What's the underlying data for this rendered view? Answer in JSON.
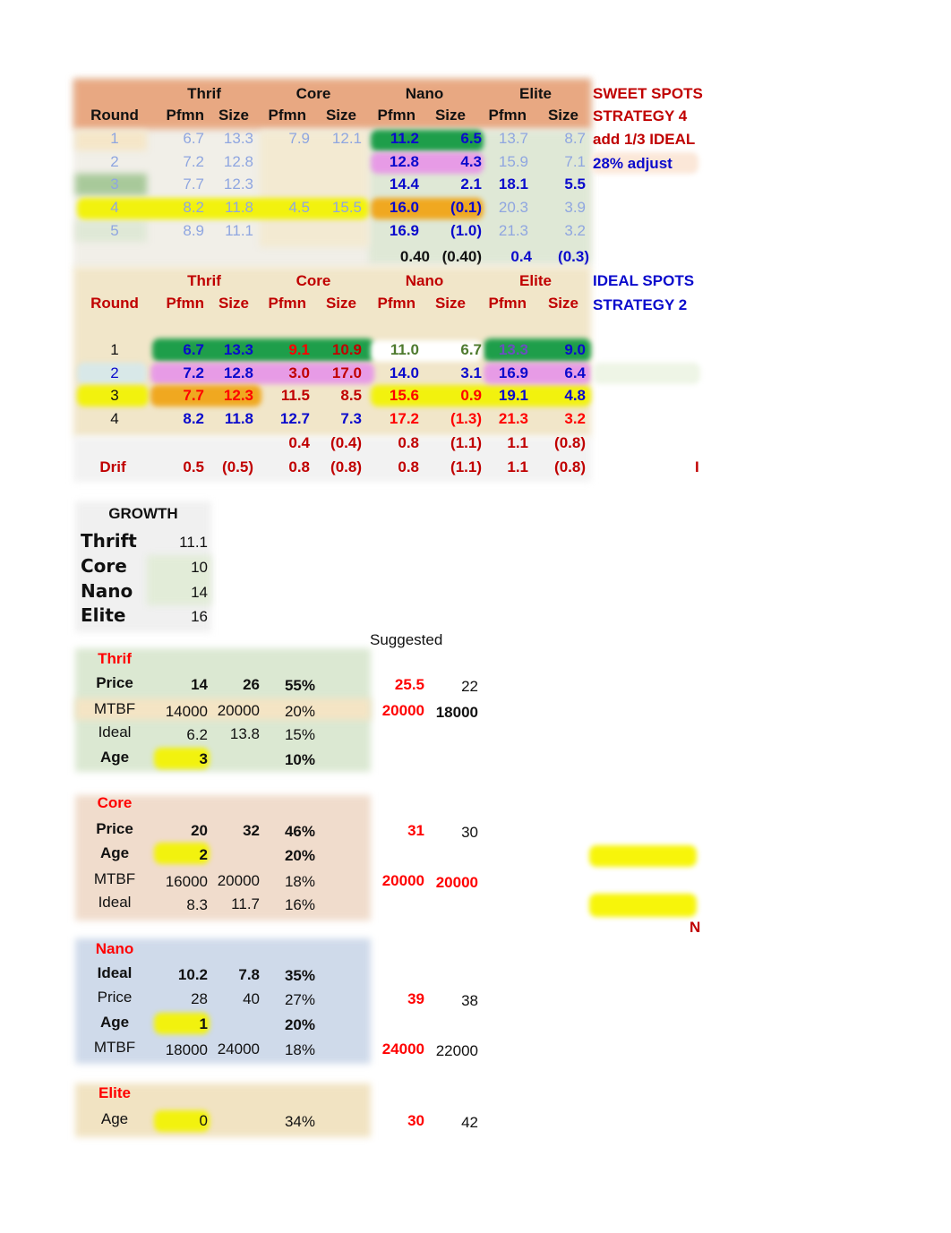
{
  "sweet_spots": {
    "side_labels": [
      "SWEET SPOTS",
      "STRATEGY 4",
      "add 1/3 IDEAL",
      "28% adjust"
    ],
    "groups": [
      "Thrif",
      "Core",
      "Nano",
      "Elite"
    ],
    "headers": [
      "Round",
      "Pfmn",
      "Size",
      "Pfmn",
      "Size",
      "Pfmn",
      "Size",
      "Pfmn",
      "Size"
    ],
    "rows": [
      [
        "1",
        "6.7",
        "13.3",
        "7.9",
        "12.1",
        "11.2",
        "6.5",
        "13.7",
        "8.7"
      ],
      [
        "2",
        "7.2",
        "12.8",
        "",
        "",
        "12.8",
        "4.3",
        "15.9",
        "7.1"
      ],
      [
        "3",
        "7.7",
        "12.3",
        "",
        "",
        "14.4",
        "2.1",
        "18.1",
        "5.5"
      ],
      [
        "4",
        "8.2",
        "11.8",
        "4.5",
        "15.5",
        "16.0",
        "(0.1)",
        "20.3",
        "3.9"
      ],
      [
        "5",
        "8.9",
        "11.1",
        "",
        "",
        "16.9",
        "(1.0)",
        "21.3",
        "3.2"
      ]
    ],
    "drift_row": [
      "0.40",
      "(0.40)",
      "0.4",
      "(0.3)"
    ]
  },
  "ideal_spots": {
    "side_labels": [
      "IDEAL SPOTS",
      "STRATEGY 2"
    ],
    "groups": [
      "Thrif",
      "Core",
      "Nano",
      "Elite"
    ],
    "headers": [
      "Round",
      "Pfmn",
      "Size",
      "Pfmn",
      "Size",
      "Pfmn",
      "Size",
      "Pfmn",
      "Size"
    ],
    "rows": [
      [
        "1",
        "6.7",
        "13.3",
        "9.1",
        "10.9",
        "11.0",
        "6.7",
        "13.3",
        "9.0"
      ],
      [
        "2",
        "7.2",
        "12.8",
        "3.0",
        "17.0",
        "14.0",
        "3.1",
        "16.9",
        "6.4"
      ],
      [
        "3",
        "7.7",
        "12.3",
        "11.5",
        "8.5",
        "15.6",
        "0.9",
        "19.1",
        "4.8"
      ],
      [
        "4",
        "8.2",
        "11.8",
        "12.7",
        "7.3",
        "17.2",
        "(1.3)",
        "21.3",
        "3.2"
      ]
    ],
    "diff_row": [
      "0.4",
      "(0.4)",
      "0.8",
      "(1.1)",
      "1.1",
      "(0.8)"
    ],
    "drif_label": "Drif",
    "drif_row": [
      "0.5",
      "(0.5)",
      "0.8",
      "(0.8)",
      "0.8",
      "(1.1)",
      "1.1",
      "(0.8)"
    ],
    "edge_mark": "I"
  },
  "growth": {
    "title": "GROWTH",
    "items": [
      {
        "label": "Thrift",
        "value": "11.1"
      },
      {
        "label": "Core",
        "value": "10"
      },
      {
        "label": "Nano",
        "value": "14"
      },
      {
        "label": "Elite",
        "value": "16"
      }
    ]
  },
  "suggested_label": "Suggested",
  "segments": {
    "thrif": {
      "title": "Thrif",
      "rows": [
        {
          "label": "Price",
          "a": "14",
          "b": "26",
          "pct": "55%",
          "s1": "25.5",
          "s2": "22"
        },
        {
          "label": "MTBF",
          "a": "14000",
          "b": "20000",
          "pct": "20%",
          "s1": "20000",
          "s2": "18000"
        },
        {
          "label": "Ideal",
          "a": "6.2",
          "b": "13.8",
          "pct": "15%"
        },
        {
          "label": "Age",
          "a": "3",
          "pct": "10%"
        }
      ]
    },
    "core": {
      "title": "Core",
      "rows": [
        {
          "label": "Price",
          "a": "20",
          "b": "32",
          "pct": "46%",
          "s1": "31",
          "s2": "30"
        },
        {
          "label": "Age",
          "a": "2",
          "pct": "20%"
        },
        {
          "label": "MTBF",
          "a": "16000",
          "b": "20000",
          "pct": "18%",
          "s1": "20000",
          "s2": "20000"
        },
        {
          "label": "Ideal",
          "a": "8.3",
          "b": "11.7",
          "pct": "16%"
        }
      ],
      "edge_mark": "N"
    },
    "nano": {
      "title": "Nano",
      "rows": [
        {
          "label": "Ideal",
          "a": "10.2",
          "b": "7.8",
          "pct": "35%"
        },
        {
          "label": "Price",
          "a": "28",
          "b": "40",
          "pct": "27%",
          "s1": "39",
          "s2": "38"
        },
        {
          "label": "Age",
          "a": "1",
          "pct": "20%"
        },
        {
          "label": "MTBF",
          "a": "18000",
          "b": "24000",
          "pct": "18%",
          "s1": "24000",
          "s2": "22000"
        }
      ]
    },
    "elite": {
      "title": "Elite",
      "rows": [
        {
          "label": "Age",
          "a": "0",
          "pct": "34%",
          "s1": "30",
          "s2": "42"
        }
      ]
    }
  },
  "colors": {
    "header_orange": "#e8a882",
    "highlight_green": "#1e9e4a",
    "highlight_pink": "#e79be6",
    "highlight_yellow": "#f2f20e",
    "highlight_orange": "#f0a820",
    "text_blue": "#0a0acc",
    "text_red": "#ff0000",
    "text_dark_red": "#c00000"
  }
}
